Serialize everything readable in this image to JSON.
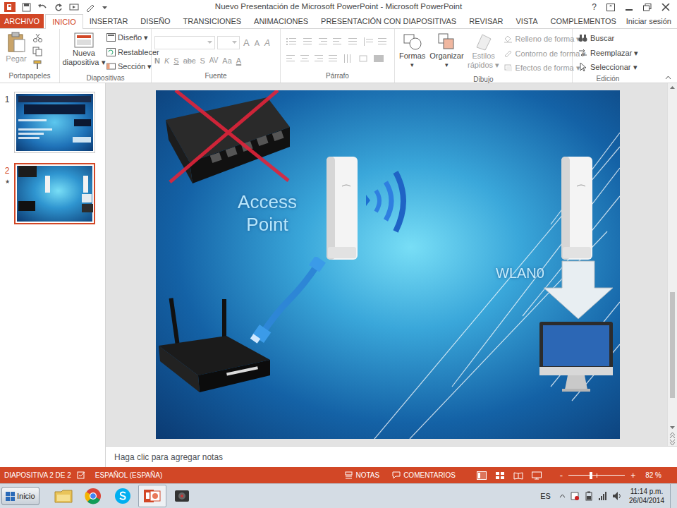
{
  "window": {
    "title": "Nuevo Presentación de Microsoft PowerPoint - Microsoft PowerPoint",
    "help": "?"
  },
  "file_tab": "ARCHIVO",
  "tabs": [
    {
      "label": "INICIO",
      "selected": true
    },
    {
      "label": "INSERTAR",
      "selected": false
    },
    {
      "label": "DISEÑO",
      "selected": false
    },
    {
      "label": "TRANSICIONES",
      "selected": false
    },
    {
      "label": "ANIMACIONES",
      "selected": false
    },
    {
      "label": "PRESENTACIÓN CON DIAPOSITIVAS",
      "selected": false
    },
    {
      "label": "REVISAR",
      "selected": false
    },
    {
      "label": "VISTA",
      "selected": false
    },
    {
      "label": "COMPLEMENTOS",
      "selected": false
    }
  ],
  "sign_in": "Iniciar sesión",
  "ribbon": {
    "clipboard": {
      "label": "Portapapeles",
      "paste": "Pegar",
      "disabled": true
    },
    "slides": {
      "label": "Diapositivas",
      "new_slide": [
        "Nueva",
        "diapositiva ▾"
      ],
      "items": [
        "Diseño ▾",
        "Restablecer",
        "Sección ▾"
      ]
    },
    "font": {
      "label": "Fuente",
      "size_buttons": [
        "A",
        "A",
        "A"
      ],
      "format_buttons": [
        "N",
        "K",
        "S",
        "abc",
        "S",
        "AV",
        "Aa",
        "A"
      ],
      "disabled": true
    },
    "paragraph": {
      "label": "Párrafo"
    },
    "drawing": {
      "label": "Dibujo",
      "shapes": [
        "Formas",
        "▾"
      ],
      "arrange": [
        "Organizar",
        "▾"
      ],
      "styles": [
        "Estilos",
        "rápidos ▾"
      ],
      "styles_disabled": true,
      "format": [
        {
          "label": "Relleno de forma ▾",
          "disabled": true
        },
        {
          "label": "Contorno de forma ▾",
          "disabled": true
        },
        {
          "label": "Efectos de forma ▾",
          "disabled": true
        }
      ]
    },
    "editing": {
      "label": "Edición",
      "items": [
        "Buscar",
        "Reemplazar ▾",
        "Seleccionar ▾"
      ]
    }
  },
  "thumbnails": [
    {
      "number": "1",
      "selected": false,
      "animated": false
    },
    {
      "number": "2",
      "selected": true,
      "animated": true
    }
  ],
  "animation_mark": "★",
  "slide": {
    "access_point": [
      "Access",
      "Point"
    ],
    "wlan": "WLAN0"
  },
  "notes_placeholder": "Haga clic para agregar notas",
  "status_bar": {
    "slide": "DIAPOSITIVA 2 DE 2",
    "language": "ESPAÑOL (ESPAÑA)",
    "notes": "NOTAS",
    "comments": "COMENTARIOS",
    "zoom_out": "-",
    "zoom_in": "+",
    "zoom": "82 %",
    "zoom_level": 0.4
  },
  "taskbar": {
    "start": "Inicio",
    "language": "ES",
    "time": "11:14 p.m.",
    "date": "26/04/2014"
  }
}
